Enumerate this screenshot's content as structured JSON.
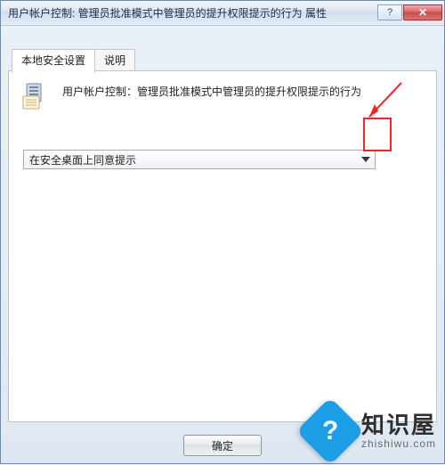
{
  "titlebar": {
    "title": "用户帐户控制: 管理员批准模式中管理员的提升权限提示的行为 属性",
    "help_glyph": "?",
    "close_glyph": "✕"
  },
  "tabs": {
    "local_security": "本地安全设置",
    "explain": "说明"
  },
  "policy": {
    "description": "用户帐户控制：管理员批准模式中管理员的提升权限提示的行为"
  },
  "dropdown": {
    "selected": "在安全桌面上同意提示"
  },
  "buttons": {
    "ok": "确定"
  },
  "watermark": {
    "badge": "?",
    "brand": "知识屋",
    "url": "zhishiwu.com"
  }
}
